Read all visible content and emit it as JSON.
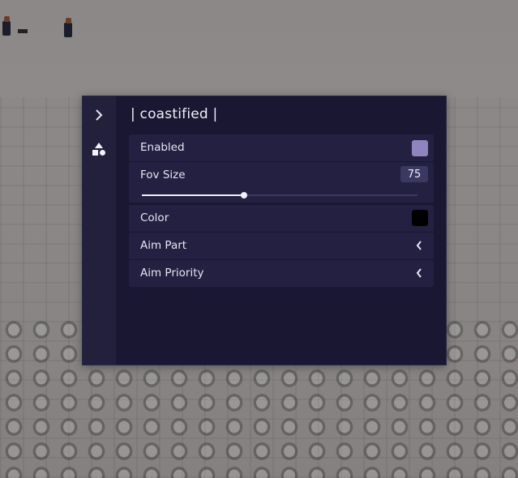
{
  "window": {
    "title": "| coastified |"
  },
  "sidebar": {
    "expand_icon": "chevron-right-icon",
    "shapes_icon": "shapes-icon"
  },
  "settings": {
    "enabled": {
      "label": "Enabled",
      "checked": true,
      "accent": "#8f84bd"
    },
    "fov_size": {
      "label": "Fov Size",
      "value": "75",
      "fraction": 0.37
    },
    "color": {
      "label": "Color",
      "swatch": "#000000"
    },
    "aim_part": {
      "label": "Aim Part",
      "icon": "chevron-left-icon"
    },
    "aim_priority": {
      "label": "Aim Priority",
      "icon": "chevron-left-icon"
    }
  },
  "theme": {
    "panel_bg": "#1b1834",
    "row_bg": "#232041",
    "text": "#e8e6f2"
  }
}
